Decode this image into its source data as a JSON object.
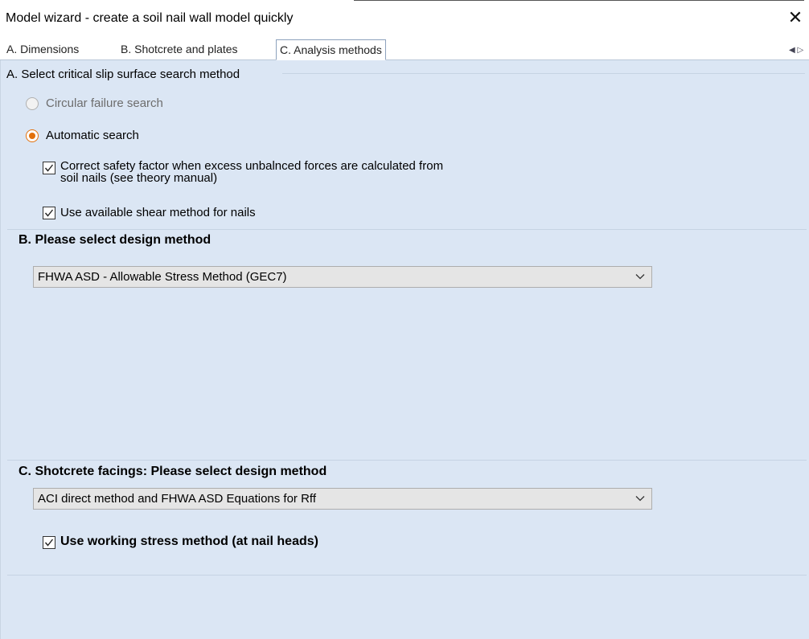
{
  "window": {
    "title": "Model wizard - create a soil nail wall model quickly",
    "close_icon": "close-icon",
    "close_glyph": "✕"
  },
  "tabs": [
    {
      "label": "A. Dimensions",
      "active": false
    },
    {
      "label": "B. Shotcrete and plates",
      "active": false
    },
    {
      "label": "C. Analysis methods",
      "active": true
    }
  ],
  "tab_scroll_icon": "tab-scroll-left-icon",
  "tab_scroll_glyph": "◀ ▷",
  "section_a": {
    "title": "A. Select critical slip surface search method",
    "radio_circular": {
      "label": "Circular failure search",
      "checked": false,
      "enabled": false
    },
    "radio_automatic": {
      "label": "Automatic search",
      "checked": true
    },
    "check_correct_fs": {
      "line1": "Correct safety factor when excess unbalnced forces are calculated from",
      "line2": "soil nails (see theory manual)",
      "checked": true
    },
    "check_shear": {
      "label": "Use available shear method for nails",
      "checked": true
    }
  },
  "section_b": {
    "title": "B. Please select design method",
    "design_method": "FHWA ASD - Allowable Stress Method (GEC7)"
  },
  "section_c": {
    "title": "C. Shotcrete facings: Please select design method",
    "design_method": "ACI direct method and FHWA ASD Equations for Rff",
    "check_working_stress": {
      "label": "Use working stress method (at nail heads)",
      "checked": true
    }
  },
  "colors": {
    "panel_bg": "#dbe6f4",
    "radio_accent": "#e2700a",
    "combo_bg": "#e5e5e5"
  }
}
